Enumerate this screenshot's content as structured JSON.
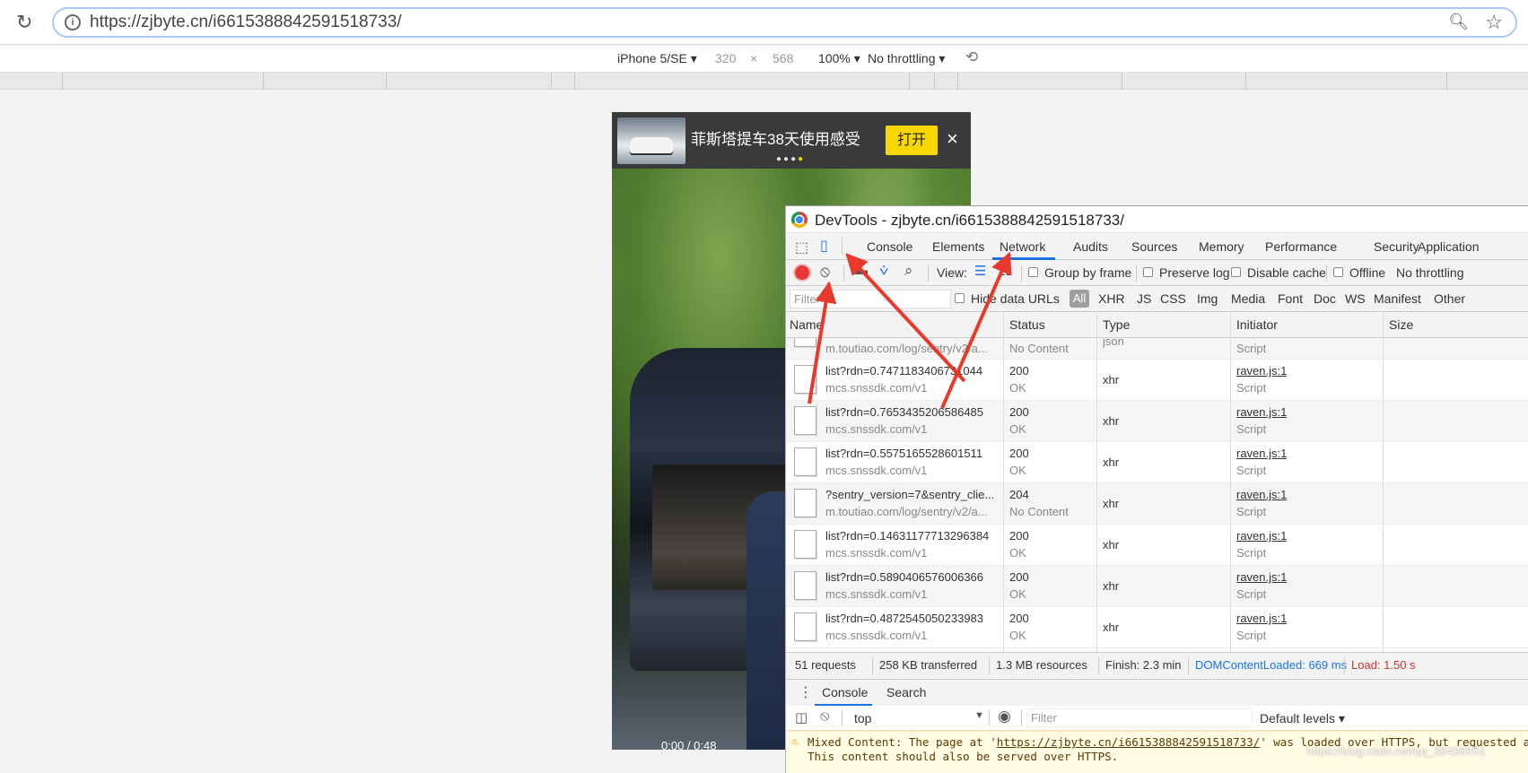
{
  "browser": {
    "url": "https://zjbyte.cn/i6615388842591518733/",
    "reload_icon": "reload-icon",
    "zoom_icon": "zoom-icon",
    "star_icon": "bookmark-star-icon"
  },
  "device_toolbar": {
    "device": "iPhone 5/SE",
    "width": "320",
    "times": "×",
    "height": "568",
    "zoom": "100%",
    "throttling": "No throttling"
  },
  "phone": {
    "banner_title": "菲斯塔提车38天使用感受",
    "open_button": "打开",
    "close": "×",
    "timecode": "0:00 / 0:48"
  },
  "devtools": {
    "title": "DevTools - zjbyte.cn/i6615388842591518733/",
    "tabs": [
      "Console",
      "Elements",
      "Network",
      "Audits",
      "Sources",
      "Memory",
      "Performance",
      "Security",
      "Application"
    ],
    "active_tab": "Network",
    "toolbar": {
      "view_label": "View:",
      "group_by_frame": "Group by frame",
      "preserve_log": "Preserve log",
      "disable_cache": "Disable cache",
      "offline": "Offline",
      "throttling": "No throttling"
    },
    "filter": {
      "placeholder": "Filter",
      "hide_data_urls": "Hide data URLs",
      "types": [
        "All",
        "XHR",
        "JS",
        "CSS",
        "Img",
        "Media",
        "Font",
        "Doc",
        "WS",
        "Manifest",
        "Other"
      ]
    },
    "columns": [
      "Name",
      "Status",
      "Type",
      "Initiator",
      "Size"
    ],
    "partial_row": {
      "name_sub": "m.toutiao.com/log/sentry/v2/a...",
      "status_sub": "No Content",
      "type": "json",
      "initiator_sub": "Script"
    },
    "rows": [
      {
        "name": "list?rdn=0.7471183406731044",
        "host": "mcs.snssdk.com/v1",
        "status": "200",
        "status_text": "OK",
        "type": "xhr",
        "initiator": "raven.js:1",
        "initiator_type": "Script"
      },
      {
        "name": "list?rdn=0.7653435206586485",
        "host": "mcs.snssdk.com/v1",
        "status": "200",
        "status_text": "OK",
        "type": "xhr",
        "initiator": "raven.js:1",
        "initiator_type": "Script"
      },
      {
        "name": "list?rdn=0.5575165528601511",
        "host": "mcs.snssdk.com/v1",
        "status": "200",
        "status_text": "OK",
        "type": "xhr",
        "initiator": "raven.js:1",
        "initiator_type": "Script"
      },
      {
        "name": "?sentry_version=7&sentry_clie...",
        "host": "m.toutiao.com/log/sentry/v2/a...",
        "status": "204",
        "status_text": "No Content",
        "type": "xhr",
        "initiator": "raven.js:1",
        "initiator_type": "Script"
      },
      {
        "name": "list?rdn=0.14631177713296384",
        "host": "mcs.snssdk.com/v1",
        "status": "200",
        "status_text": "OK",
        "type": "xhr",
        "initiator": "raven.js:1",
        "initiator_type": "Script"
      },
      {
        "name": "list?rdn=0.5890406576006366",
        "host": "mcs.snssdk.com/v1",
        "status": "200",
        "status_text": "OK",
        "type": "xhr",
        "initiator": "raven.js:1",
        "initiator_type": "Script"
      },
      {
        "name": "list?rdn=0.4872545050233983",
        "host": "mcs.snssdk.com/v1",
        "status": "200",
        "status_text": "OK",
        "type": "xhr",
        "initiator": "raven.js:1",
        "initiator_type": "Script"
      }
    ],
    "status_bar": {
      "requests": "51 requests",
      "transferred": "258 KB transferred",
      "resources": "1.3 MB resources",
      "finish": "Finish: 2.3 min",
      "dcl": "DOMContentLoaded: 669 ms",
      "load": "Load: 1.50 s"
    },
    "drawer": {
      "tabs": [
        "Console",
        "Search"
      ],
      "context": "top",
      "filter_placeholder": "Filter",
      "levels": "Default levels"
    },
    "warning": {
      "prefix": "Mixed Content: The page at '",
      "link": "https://zjbyte.cn/i6615388842591518733/",
      "suffix": "' was loaded over HTTPS, but requested an",
      "line2": "This content should also be served over HTTPS."
    },
    "watermark": "https://blog.csdn.net/qq_38498951",
    "colors": {
      "accent": "#1a73e8",
      "record": "#e53935",
      "arrow": "#e8392c",
      "dcl": "#1a73e8",
      "load": "#d32f2f"
    }
  }
}
